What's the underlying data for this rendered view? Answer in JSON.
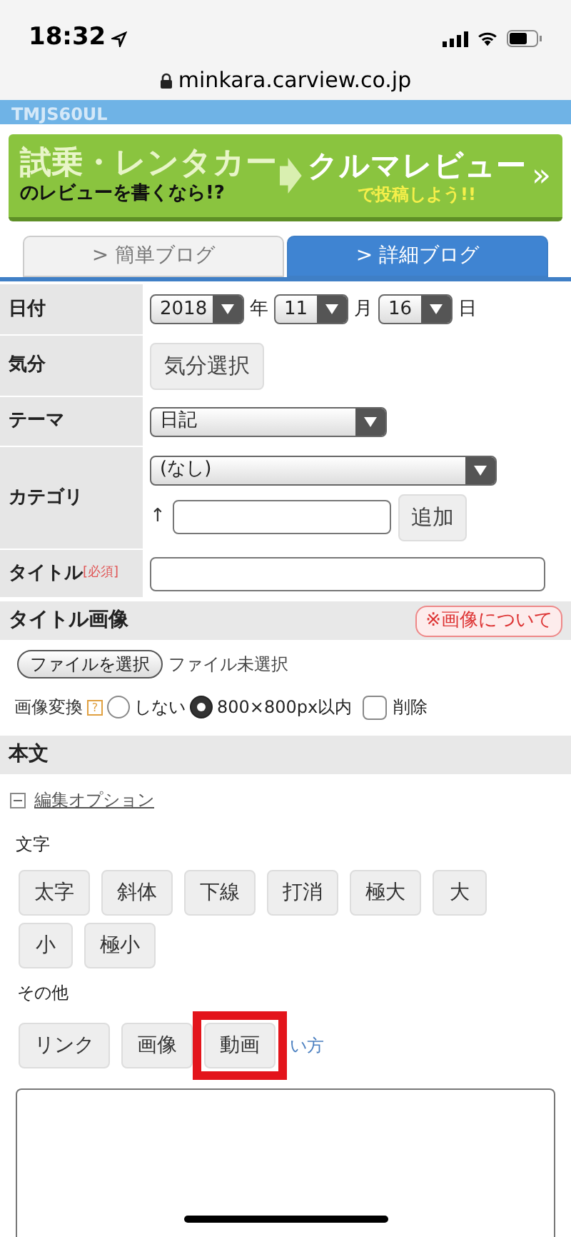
{
  "status_bar": {
    "time": "18:32"
  },
  "address_bar": {
    "url": "minkara.carview.co.jp"
  },
  "header": {
    "text": "TMJS60UL"
  },
  "banner": {
    "line_1": "試乗・レンタカー",
    "line_2": "のレビューを書くなら!?",
    "line_3": "クルマレビュー",
    "line_4": "で投稿しよう!!",
    "chevron": "»"
  },
  "tabs": [
    {
      "label": "> 簡単ブログ",
      "selected": false
    },
    {
      "label": "> 詳細ブログ",
      "selected": true
    }
  ],
  "form": {
    "date": {
      "label": "日付",
      "year": "2018",
      "year_unit": "年",
      "month": "11",
      "month_unit": "月",
      "day": "16",
      "day_unit": "日"
    },
    "mood": {
      "label": "気分",
      "button": "気分選択"
    },
    "theme": {
      "label": "テーマ",
      "value": "日記"
    },
    "category": {
      "label": "カテゴリ",
      "value": "(なし)",
      "arrow": "↑",
      "add_button": "追加"
    },
    "title": {
      "label": "タイトル",
      "required": "[必須]"
    }
  },
  "title_image": {
    "heading": "タイトル画像",
    "about_button": "※画像について",
    "file_button": "ファイルを選択",
    "file_status": "ファイル未選択",
    "convert_label": "画像変換",
    "help": "?",
    "options": [
      {
        "label": "しない",
        "selected": false
      },
      {
        "label": "800×800px以内",
        "selected": true
      }
    ],
    "delete": {
      "label": "削除",
      "checked": false
    }
  },
  "body": {
    "heading": "本文",
    "options_link": "編集オプション",
    "expanded": true,
    "text_label": "文字",
    "text_buttons": [
      "太字",
      "斜体",
      "下線",
      "打消",
      "極大",
      "大",
      "小",
      "極小"
    ],
    "other_label": "その他",
    "other_buttons": [
      {
        "label": "リンク",
        "highlighted": false
      },
      {
        "label": "画像",
        "highlighted": false
      },
      {
        "label": "動画",
        "highlighted": true
      }
    ],
    "usage_link": "い方"
  }
}
